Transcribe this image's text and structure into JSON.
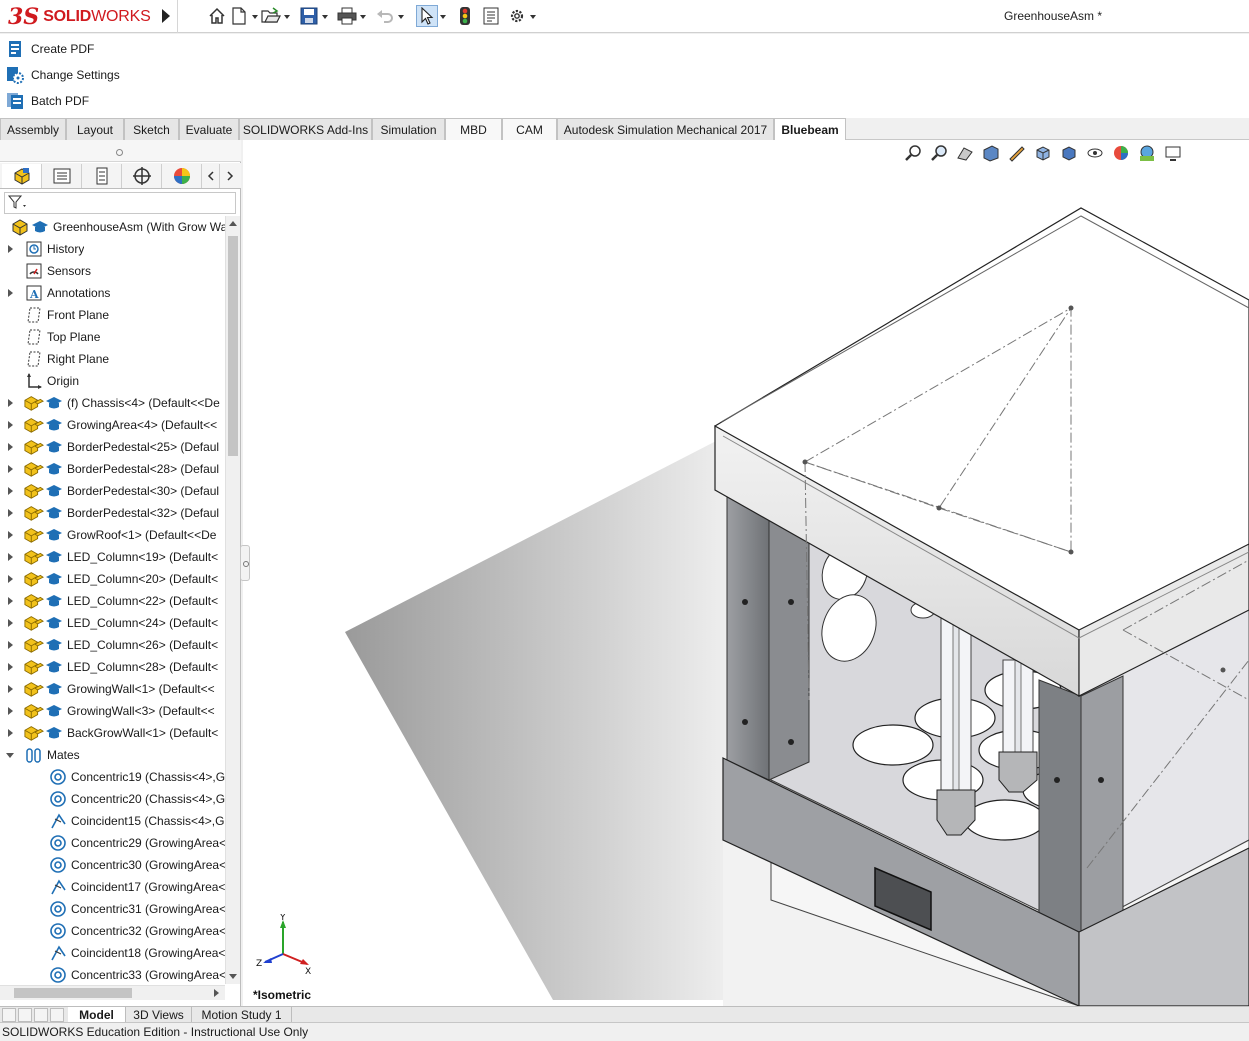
{
  "app": {
    "logo_ds": "3S",
    "logo_text_bold": "SOLID",
    "logo_text_light": "WORKS",
    "document_title": "GreenhouseAsm *"
  },
  "quick_access": [
    "home-icon",
    "new-document-icon",
    "open-icon",
    "save-icon",
    "print-icon",
    "undo-icon",
    "select-icon",
    "rebuild-icon",
    "file-properties-icon",
    "options-icon"
  ],
  "pdf_commands": [
    {
      "label": "Create PDF",
      "icon": "create-pdf-icon"
    },
    {
      "label": "Change Settings",
      "icon": "change-settings-icon"
    },
    {
      "label": "Batch PDF",
      "icon": "batch-pdf-icon"
    }
  ],
  "tabs": [
    {
      "label": "Assembly"
    },
    {
      "label": "Layout"
    },
    {
      "label": "Sketch"
    },
    {
      "label": "Evaluate"
    },
    {
      "label": "SOLIDWORKS Add-Ins"
    },
    {
      "label": "Simulation"
    },
    {
      "label": "MBD"
    },
    {
      "label": "CAM"
    },
    {
      "label": "Autodesk Simulation Mechanical 2017"
    },
    {
      "label": "Bluebeam",
      "active": true
    }
  ],
  "feature_tree": {
    "root": "GreenhouseAsm  (With Grow Wa",
    "items": [
      {
        "label": "History",
        "icon": "history-icon",
        "exp": "c"
      },
      {
        "label": "Sensors",
        "icon": "sensors-icon",
        "exp": ""
      },
      {
        "label": "Annotations",
        "icon": "annotations-icon",
        "exp": "c"
      },
      {
        "label": "Front Plane",
        "icon": "plane-icon",
        "exp": ""
      },
      {
        "label": "Top Plane",
        "icon": "plane-icon",
        "exp": ""
      },
      {
        "label": "Right Plane",
        "icon": "plane-icon",
        "exp": ""
      },
      {
        "label": "Origin",
        "icon": "origin-icon",
        "exp": ""
      },
      {
        "label": "(f) Chassis<4> (Default<<De",
        "icon": "component-icon",
        "exp": "c"
      },
      {
        "label": "GrowingArea<4> (Default<<",
        "icon": "component-icon",
        "exp": "c"
      },
      {
        "label": "BorderPedestal<25> (Defaul",
        "icon": "component-icon",
        "exp": "c"
      },
      {
        "label": "BorderPedestal<28> (Defaul",
        "icon": "component-icon",
        "exp": "c"
      },
      {
        "label": "BorderPedestal<30> (Defaul",
        "icon": "component-icon",
        "exp": "c"
      },
      {
        "label": "BorderPedestal<32> (Defaul",
        "icon": "component-icon",
        "exp": "c"
      },
      {
        "label": "GrowRoof<1> (Default<<De",
        "icon": "component-icon",
        "exp": "c"
      },
      {
        "label": "LED_Column<19> (Default<",
        "icon": "component-icon",
        "exp": "c"
      },
      {
        "label": "LED_Column<20> (Default<",
        "icon": "component-icon",
        "exp": "c"
      },
      {
        "label": "LED_Column<22> (Default<",
        "icon": "component-icon",
        "exp": "c"
      },
      {
        "label": "LED_Column<24> (Default<",
        "icon": "component-icon",
        "exp": "c"
      },
      {
        "label": "LED_Column<26> (Default<",
        "icon": "component-icon",
        "exp": "c"
      },
      {
        "label": "LED_Column<28> (Default<",
        "icon": "component-icon",
        "exp": "c"
      },
      {
        "label": "GrowingWall<1> (Default<<",
        "icon": "component-icon",
        "exp": "c"
      },
      {
        "label": "GrowingWall<3> (Default<<",
        "icon": "component-icon",
        "exp": "c"
      },
      {
        "label": "BackGrowWall<1> (Default<",
        "icon": "component-icon",
        "exp": "c"
      },
      {
        "label": "Mates",
        "icon": "mates-icon",
        "exp": "o"
      },
      {
        "label": "Concentric19 (Chassis<4>,G",
        "icon": "concentric-mate-icon",
        "exp": "",
        "indent": true
      },
      {
        "label": "Concentric20 (Chassis<4>,G",
        "icon": "concentric-mate-icon",
        "exp": "",
        "indent": true
      },
      {
        "label": "Coincident15 (Chassis<4>,G",
        "icon": "coincident-mate-icon",
        "exp": "",
        "indent": true
      },
      {
        "label": "Concentric29 (GrowingArea<",
        "icon": "concentric-mate-icon",
        "exp": "",
        "indent": true
      },
      {
        "label": "Concentric30 (GrowingArea<",
        "icon": "concentric-mate-icon",
        "exp": "",
        "indent": true
      },
      {
        "label": "Coincident17 (GrowingArea<",
        "icon": "coincident-mate-icon",
        "exp": "",
        "indent": true
      },
      {
        "label": "Concentric31 (GrowingArea<",
        "icon": "concentric-mate-icon",
        "exp": "",
        "indent": true
      },
      {
        "label": "Concentric32 (GrowingArea<",
        "icon": "concentric-mate-icon",
        "exp": "",
        "indent": true
      },
      {
        "label": "Coincident18 (GrowingArea<",
        "icon": "coincident-mate-icon",
        "exp": "",
        "indent": true
      },
      {
        "label": "Concentric33 (GrowingArea<",
        "icon": "concentric-mate-icon",
        "exp": "",
        "indent": true
      }
    ]
  },
  "viewport": {
    "view_label": "*Isometric",
    "triad": {
      "x": "X",
      "y": "Y",
      "z": "Z"
    }
  },
  "bottom_tabs": [
    {
      "label": "Model",
      "active": true
    },
    {
      "label": "3D Views"
    },
    {
      "label": "Motion Study 1"
    }
  ],
  "status_text": "SOLIDWORKS Education Edition - Instructional Use Only",
  "colors": {
    "brand": "#d01a1f",
    "component_yellow": "#f2c21b",
    "mate_blue": "#1f6fb5"
  }
}
